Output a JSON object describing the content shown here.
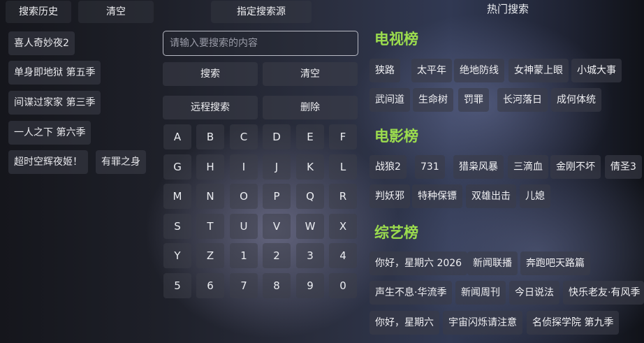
{
  "header": {
    "history_title": "搜索历史",
    "clear_label": "清空",
    "source_label": "指定搜索源",
    "hot_title": "热门搜索"
  },
  "history": [
    "喜人奇妙夜2",
    "单身即地狱 第五季",
    "间谍过家家 第三季",
    "一人之下 第六季",
    "超时空辉夜姬！",
    "有罪之身"
  ],
  "search": {
    "placeholder": "请输入要搜索的内容",
    "search_label": "搜索",
    "clear_label": "清空",
    "remote_label": "远程搜索",
    "delete_label": "删除"
  },
  "keyboard": [
    [
      "A",
      "B",
      "C",
      "D",
      "E",
      "F"
    ],
    [
      "G",
      "H",
      "I",
      "J",
      "K",
      "L"
    ],
    [
      "M",
      "N",
      "O",
      "P",
      "Q",
      "R"
    ],
    [
      "S",
      "T",
      "U",
      "V",
      "W",
      "X"
    ],
    [
      "Y",
      "Z",
      "1",
      "2",
      "3",
      "4"
    ],
    [
      "5",
      "6",
      "7",
      "8",
      "9",
      "0"
    ]
  ],
  "hot": {
    "tv": {
      "title": "电视榜",
      "items": [
        "狭路",
        "太平年",
        "绝地防线",
        "女神蒙上眼",
        "小城大事",
        "武间道",
        "生命树",
        "罚罪",
        "长河落日",
        "成何体统"
      ]
    },
    "movie": {
      "title": "电影榜",
      "items": [
        "战狼2",
        "731",
        "猎枭风暴",
        "三滴血",
        "金刚不坏",
        "倩圣3",
        "判妖邪",
        "特种保镖",
        "双雄出击",
        "儿媳"
      ]
    },
    "variety": {
      "title": "综艺榜",
      "items": [
        "你好，星期六 2026",
        "新闻联播",
        "奔跑吧天路篇",
        "声生不息·华流季",
        "新闻周刊",
        "今日说法",
        "快乐老友·有风季",
        "你好，星期六",
        "宇宙闪烁请注意",
        "名侦探学院 第九季"
      ]
    }
  }
}
